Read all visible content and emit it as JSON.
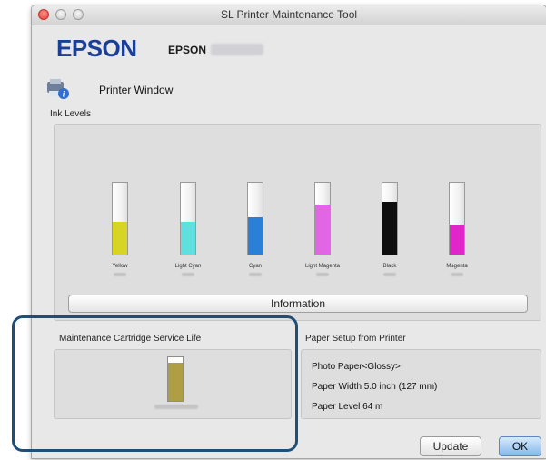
{
  "window": {
    "title": "SL Printer Maintenance Tool"
  },
  "brand": {
    "logo": "EPSON",
    "model_prefix": "EPSON"
  },
  "printer_window": {
    "label": "Printer Window",
    "icon": "printer-info-icon"
  },
  "ink_levels": {
    "label": "Ink Levels",
    "inks": [
      {
        "name": "Yellow",
        "level": 0.45,
        "color": "#d8d423"
      },
      {
        "name": "Light Cyan",
        "level": 0.45,
        "color": "#5ee0df"
      },
      {
        "name": "Cyan",
        "level": 0.52,
        "color": "#2a7fd6"
      },
      {
        "name": "Light Magenta",
        "level": 0.7,
        "color": "#e165e4"
      },
      {
        "name": "Black",
        "level": 0.74,
        "color": "#0e0e0e"
      },
      {
        "name": "Magenta",
        "level": 0.42,
        "color": "#e026c9"
      }
    ]
  },
  "information_button": {
    "label": "Information"
  },
  "maintenance": {
    "label": "Maintenance Cartridge Service Life",
    "level": 0.88,
    "color": "#b09e45"
  },
  "paper": {
    "label": "Paper Setup from Printer",
    "type": "Photo Paper<Glossy>",
    "width": "Paper Width 5.0 inch (127 mm)",
    "level": "Paper Level 64 m"
  },
  "buttons": {
    "update": "Update",
    "ok": "OK"
  },
  "highlight_color": "#1f4e79"
}
